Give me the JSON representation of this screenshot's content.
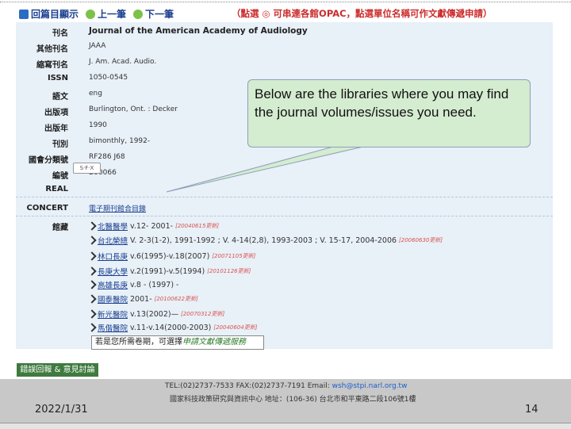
{
  "nav": {
    "back": "回篇目顯示",
    "prev": "上一筆",
    "next": "下一筆",
    "notice": "（點選 ◎ 可串連各館OPAC，點選單位名稱可作文獻傳遞申請）"
  },
  "record": {
    "fields": [
      {
        "label": "刊名",
        "value": "Journal of the American Academy of Audiology"
      },
      {
        "label": "其他刊名",
        "value": "JAAA"
      },
      {
        "label": "縮寫刊名",
        "value": "J. Am. Acad. Audio."
      },
      {
        "label": "ISSN",
        "value": "1050-0545"
      },
      {
        "label": "語文",
        "value": "eng"
      },
      {
        "label": "出版項",
        "value": "Burlington, Ont. : Decker"
      },
      {
        "label": "出版年",
        "value": "1990"
      },
      {
        "label": "刊別",
        "value": "bimonthly, 1992-"
      },
      {
        "label": "國會分類號",
        "value": "RF286 J68"
      },
      {
        "label": "編號",
        "value": "B00066"
      }
    ],
    "real_label": "REAL",
    "real_badge": "S·F·X",
    "concert_label": "CONCERT",
    "concert_value": "電子期刊館合目錄",
    "holdings_label": "館藏"
  },
  "holdings": [
    {
      "library": "北醫醫學",
      "text": "v.12- 2001-",
      "note": "[20040615更新]"
    },
    {
      "library": "台北榮總",
      "text": "V. 2-3(1-2), 1991-1992 ; V. 4-14(2,8), 1993-2003 ; V. 15-17, 2004-2006",
      "note": "[20060630更新]"
    },
    {
      "library": "林口長庚",
      "text": "v.6(1995)-v.18(2007)",
      "note": "[20071105更新]"
    },
    {
      "library": "長庚大學",
      "text": "v.2(1991)-v.5(1994)",
      "note": "[20101126更新]"
    },
    {
      "library": "高雄長庚",
      "text": "v.8 - (1997) -",
      "note": ""
    },
    {
      "library": "國泰醫院",
      "text": "2001-",
      "note": "[20100622更新]"
    },
    {
      "library": "新光醫院",
      "text": "v.13(2002)—",
      "note": "[20070312更新]"
    },
    {
      "library": "馬偕醫院",
      "text": "v.11-v.14(2000-2003)",
      "note": "[20040604更新]"
    }
  ],
  "tip": {
    "text": "若是您所需卷期，可選擇",
    "link": "申請文獻傳遞服務"
  },
  "feedback_label": "錯誤回報 & 意見討論",
  "footer": {
    "contact": "TEL:(02)2737-7533    FAX:(02)2737-7191    Email:",
    "email": "wsh@stpi.narl.org.tw",
    "address": "國家科技政策研究與資訊中心 地址：(106-36) 台北市和平東路二段106號1樓"
  },
  "callout": {
    "text": "Below are the libraries where you may find the journal volumes/issues you need."
  },
  "slide": {
    "date": "2022/1/31",
    "number": "14"
  }
}
